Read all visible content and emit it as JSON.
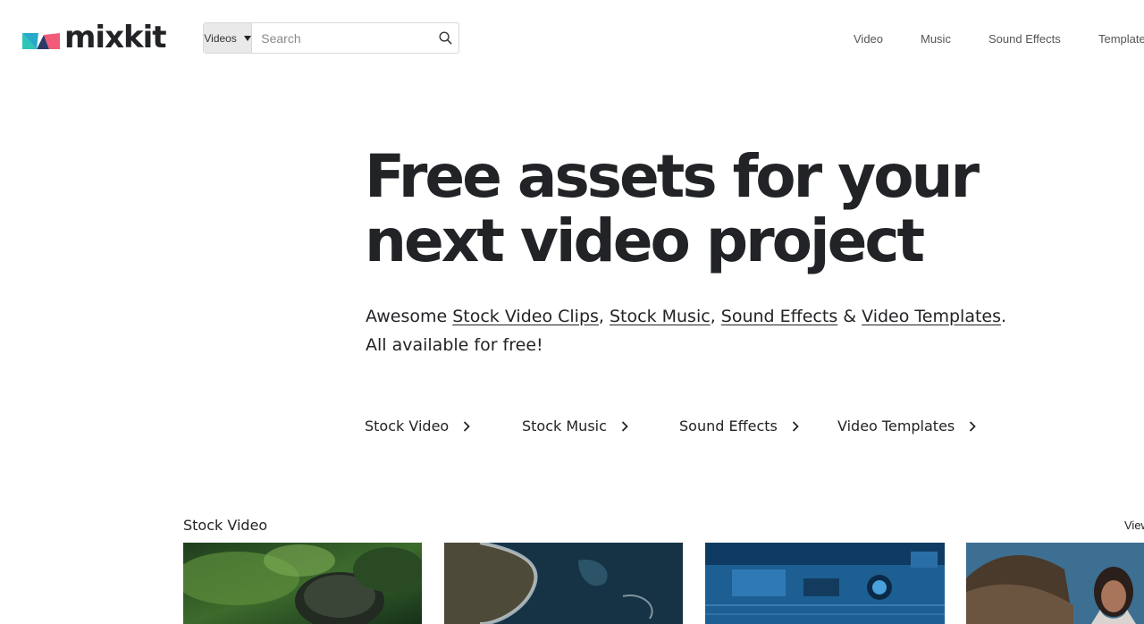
{
  "header": {
    "logo_text": "mixkit",
    "search": {
      "type_label": "Videos",
      "placeholder": "Search"
    },
    "nav": {
      "video": "Video",
      "music": "Music",
      "sound_effects": "Sound Effects",
      "templates": "Templates"
    }
  },
  "hero": {
    "title_line1": "Free assets for your",
    "title_line2": "next video project",
    "sub_prefix": "Awesome ",
    "link_stock_video": "Stock Video Clips",
    "sep1": ", ",
    "link_stock_music": "Stock Music",
    "sep2": ", ",
    "link_sound_effects": "Sound Effects",
    "sep3": " & ",
    "link_video_templates": "Video Templates",
    "sep4": ".",
    "sub_line2": "All available for free!"
  },
  "quicklinks": {
    "stock_video": "Stock Video",
    "stock_music": "Stock Music",
    "sound_effects": "Sound Effects",
    "video_templates": "Video Templates"
  },
  "stock_video_section": {
    "title": "Stock Video",
    "view_all": "View all"
  },
  "colors": {
    "text": "#222326",
    "logo_teal": "#2ec4b6",
    "logo_pink": "#f25c78",
    "logo_blue": "#2b3a67"
  }
}
